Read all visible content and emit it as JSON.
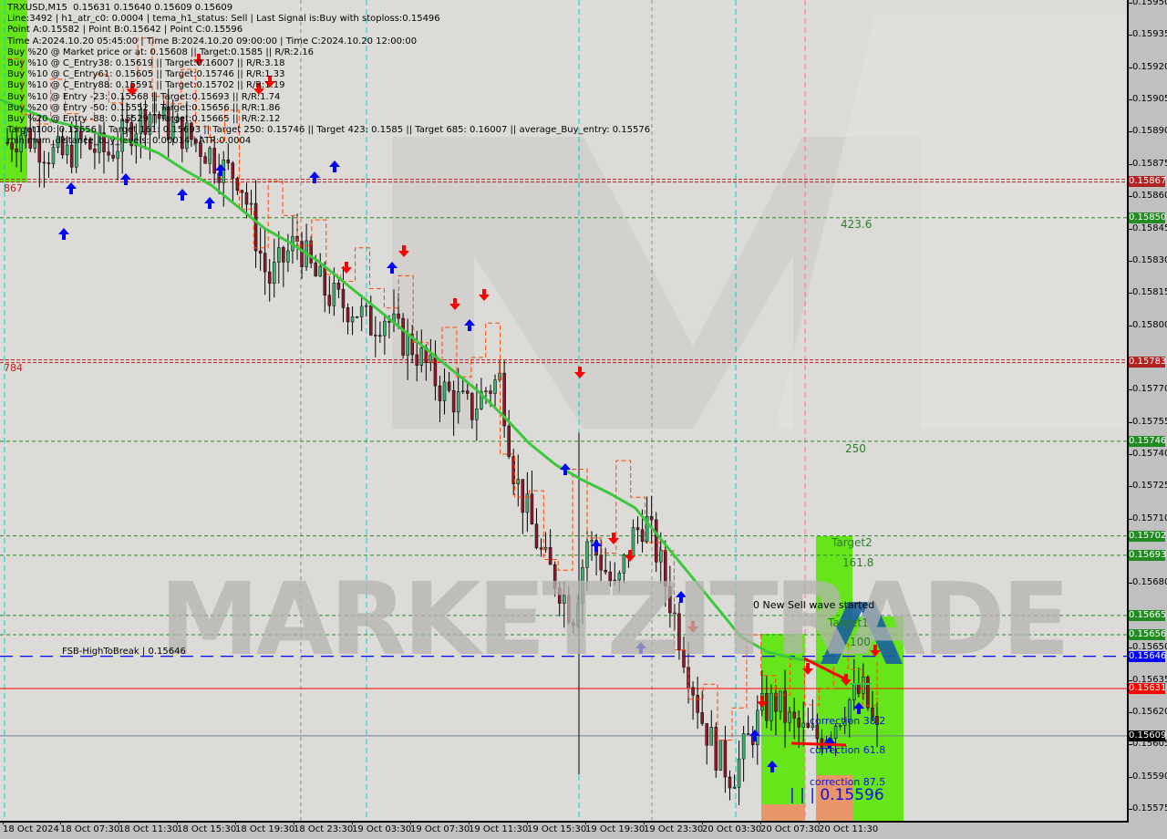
{
  "chart_data": {
    "type": "candlestick",
    "symbol": "TRXUSD",
    "timeframe": "M15",
    "ohlc_header": {
      "open": 0.15631,
      "high": 0.1564,
      "low": 0.15609,
      "close": 0.15609
    },
    "title": "TRXUSD,M15  0.15631 0.15640 0.15609 0.15609",
    "ylim": [
      0.1557,
      0.1595
    ],
    "y_ticks": [
      "0.15950",
      "0.15935",
      "0.15920",
      "0.15905",
      "0.15890",
      "0.15875",
      "0.15860",
      "0.15845",
      "0.15830",
      "0.15815",
      "0.15800",
      "0.15770",
      "0.15755",
      "0.15740",
      "0.15725",
      "0.15710",
      "0.15680",
      "0.15650",
      "0.15635",
      "0.15620",
      "0.15605",
      "0.15590",
      "0.15575"
    ],
    "x_ticks": [
      "18 Oct 2024",
      "18 Oct 07:30",
      "18 Oct 11:30",
      "18 Oct 15:30",
      "18 Oct 19:30",
      "18 Oct 23:30",
      "19 Oct 03:30",
      "19 Oct 07:30",
      "19 Oct 11:30",
      "19 Oct 15:30",
      "19 Oct 19:30",
      "19 Oct 23:30",
      "20 Oct 03:30",
      "20 Oct 07:30",
      "20 Oct 11:30"
    ],
    "close_path": [
      0.15885,
      0.1589,
      0.15885,
      0.1588,
      0.15878,
      0.15885,
      0.15882,
      0.1588,
      0.15888,
      0.15895,
      0.159,
      0.15893,
      0.1589,
      0.15885,
      0.1588,
      0.15872,
      0.1587,
      0.15845,
      0.1582,
      0.1583,
      0.1584,
      0.15825,
      0.15815,
      0.1581,
      0.15808,
      0.158,
      0.15805,
      0.15795,
      0.1579,
      0.1578,
      0.1577,
      0.15765,
      0.1576,
      0.1577,
      0.15775,
      0.1573,
      0.1571,
      0.1569,
      0.1568,
      0.15665,
      0.157,
      0.1569,
      0.15675,
      0.157,
      0.1571,
      0.1569,
      0.15665,
      0.1564,
      0.15615,
      0.156,
      0.1559,
      0.15605,
      0.1562,
      0.15625,
      0.15615,
      0.1561,
      0.15608,
      0.15615,
      0.15625,
      0.1563,
      0.15609
    ],
    "moving_average": [
      0.15905,
      0.159,
      0.15895,
      0.15892,
      0.15888,
      0.15885,
      0.1588,
      0.15872,
      0.15865,
      0.15855,
      0.15845,
      0.15838,
      0.1583,
      0.1582,
      0.1581,
      0.158,
      0.1579,
      0.1578,
      0.1577,
      0.15758,
      0.15745,
      0.15735,
      0.15728,
      0.15722,
      0.15715,
      0.157,
      0.15685,
      0.1567,
      0.15655,
      0.15648,
      0.15645,
      0.15643
    ],
    "horizontal_levels": [
      {
        "price": 0.15867,
        "label": "0.15867",
        "style": "dashed-double",
        "color": "#b22222",
        "left_label": "867"
      },
      {
        "price": 0.1585,
        "label": "0.15850",
        "style": "dashed",
        "color": "#228b22",
        "level_text": "423.6"
      },
      {
        "price": 0.15783,
        "label": "0.15783",
        "style": "dashed-double",
        "color": "#b22222",
        "left_label": "784"
      },
      {
        "price": 0.15746,
        "label": "0.15746",
        "style": "dashed",
        "color": "#228b22",
        "level_text": "250"
      },
      {
        "price": 0.15702,
        "label": "0.15702",
        "style": "dashed",
        "color": "#228b22"
      },
      {
        "price": 0.15693,
        "label": "0.15693",
        "style": "dashed",
        "color": "#228b22",
        "level_text": "161.8"
      },
      {
        "price": 0.15665,
        "label": "0.15665",
        "style": "dashed",
        "color": "#228b22"
      },
      {
        "price": 0.15656,
        "label": "0.15656",
        "style": "dashed",
        "color": "#228b22",
        "level_text": "100"
      },
      {
        "price": 0.15646,
        "label": "0.15646",
        "style": "dashed-blue",
        "color": "#0000ff",
        "line_text": "FSB-HighToBreak | 0.15646"
      },
      {
        "price": 0.15631,
        "label": "0.15631",
        "style": "solid",
        "color": "#ff0000"
      },
      {
        "price": 0.15609,
        "label": "0.15609",
        "style": "solid",
        "color": "#708090"
      }
    ]
  },
  "info_lines": [
    "TRXUSD,M15  0.15631 0.15640 0.15609 0.15609",
    "Line:3492 | h1_atr_c0: 0.0004 | tema_h1_status: Sell | Last Signal is:Buy with stoploss:0.15496",
    "Point A:0.15582 | Point B:0.15642 | Point C:0.15596",
    "Time A:2024.10.20 05:45:00 | Time B:2024.10.20 09:00:00 | Time C:2024.10.20 12:00:00",
    "Buy %20 @ Market price or at: 0.15608 || Target:0.1585 || R/R:2.16",
    "Buy %10 @ C_Entry38: 0.15619 || Target:0.16007 || R/R:3.18",
    "Buy %10 @ C_Entry61: 0.15605 || Target:0.15746 || R/R:1.33",
    "Buy %10 @ C_Entry88: 0.15591 || Target:0.15702 || R/R:1.19",
    "Buy %10 @ Entry -23: 0.15568 || Target:0.15693 || R/R:1.74",
    "Buy %20 @ Entry -50: 0.15552 || Target:0.15656 || R/R:1.86",
    "Buy %20 @ Entry -88: 0.15529 || Target:0.15665 || R/R:2.12",
    "Target100: 0.15656 || Target 161: 0.15693 || Target 250: 0.15746 || Target 423: 0.1585 || Target 685: 0.16007 || average_Buy_entry: 0.15576",
    "minimum_distance_buy_levels: 0.00014 | ATR:0.0004"
  ],
  "annotations": {
    "new_sell_wave": "0 New Sell wave started",
    "target2": "Target2",
    "target1": "Target1",
    "correction_38": "correction 38.2",
    "correction_61": "correction 61.8",
    "correction_87": "correction 87.5",
    "point_c_value": "| | | 0.15596",
    "level_423": "423.6",
    "level_250": "250",
    "level_161": "161.8",
    "level_100": "100",
    "fsb_label": "FSB-HighToBreak | 0.15646",
    "left_867": "867",
    "left_784": "784"
  },
  "price_badges": [
    {
      "value": "0.15867",
      "color": "#b22222"
    },
    {
      "value": "0.15850",
      "color": "#228b22"
    },
    {
      "value": "0.15783",
      "color": "#b22222"
    },
    {
      "value": "0.15746",
      "color": "#228b22"
    },
    {
      "value": "0.15702",
      "color": "#228b22"
    },
    {
      "value": "0.15693",
      "color": "#228b22"
    },
    {
      "value": "0.15665",
      "color": "#228b22"
    },
    {
      "value": "0.15656",
      "color": "#228b22"
    },
    {
      "value": "0.15646",
      "color": "#0000ff"
    },
    {
      "value": "0.15631",
      "color": "#ff0000"
    },
    {
      "value": "0.15609",
      "color": "#000000"
    }
  ],
  "watermark": "MARKETZITRADE",
  "colors": {
    "bull_candle": "#3cb371",
    "bear_candle": "#8b1a2b",
    "ma_line": "#3cc83c",
    "stop_line": "#ff4500",
    "buy_arrow": "#0000ff",
    "sell_arrow": "#ff0000",
    "zone_green": "#66e61a",
    "zone_orange": "#e8956a"
  }
}
